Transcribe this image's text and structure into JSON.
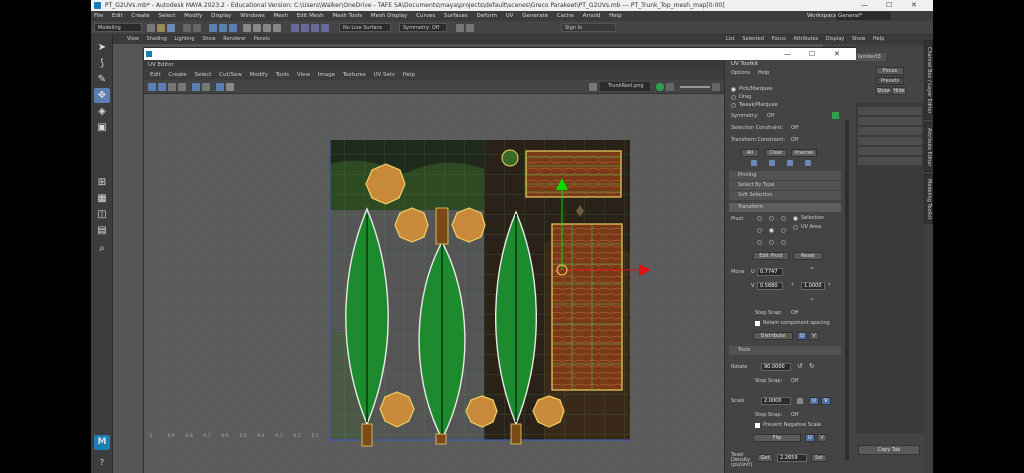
{
  "titlebar": {
    "title": "PT_G2UVs.mb* - Autodesk MAYA 2023.2 - Educational Version: C:\\Users\\Walker\\OneDrive - TAFE SA\\Documents\\maya\\projects\\default\\scenes\\Greco Parakeet\\PT_G2UVs.mb  ---  PT_Trunk_Top_mesh_map[0:00]"
  },
  "menubar": {
    "items": [
      "File",
      "Edit",
      "Create",
      "Select",
      "Modify",
      "Display",
      "Windows",
      "Mesh",
      "Edit Mesh",
      "Mesh Tools",
      "Mesh Display",
      "Curves",
      "Surfaces",
      "Deform",
      "UV",
      "Generate",
      "Cache",
      "Arnold",
      "Help"
    ],
    "workspace_label": "Workspace:",
    "workspace_value": "General*"
  },
  "shelf": {
    "mode": "Modeling",
    "live_surface": "No Live Surface",
    "symmetry": "Symmetry: Off",
    "sign_in": "Sign In"
  },
  "viewport_menu": {
    "items": [
      "View",
      "Shading",
      "Lighting",
      "Show",
      "Renderer",
      "Panels"
    ]
  },
  "uv_editor": {
    "title": "UV Editor",
    "menu": [
      "Edit",
      "Create",
      "Select",
      "Cut/Sew",
      "Modify",
      "Tools",
      "View",
      "Image",
      "Textures",
      "UV Sets",
      "Help"
    ],
    "texture_name": "TrunkRest.png",
    "axis_labels": [
      "-1",
      "-0.9",
      "-0.8",
      "-0.7",
      "-0.6",
      "-0.5",
      "-0.4",
      "-0.3",
      "-0.2",
      "-0.1"
    ]
  },
  "toolkit": {
    "title": "UV Toolkit",
    "menu": [
      "Options",
      "Help"
    ],
    "selection_modes": [
      "Pick/Marquee",
      "Drag",
      "Tweak/Marquee"
    ],
    "symmetry_label": "Symmetry:",
    "symmetry_value": "Off",
    "selection_constraint_label": "Selection Constraint:",
    "selection_constraint_value": "Off",
    "transform_constraint_label": "Transform Constraint:",
    "transform_constraint_value": "Off",
    "buttons_all": "All",
    "buttons_clear": "Clear",
    "buttons_inverse": "Inverse",
    "sections": [
      "Pinning",
      "Select By Type",
      "Soft Selection",
      "Transform",
      "Tools"
    ],
    "pivot_label": "Pivot",
    "pivot_selection": "Selection",
    "pivot_uv_area": "UV Area",
    "edit_pivot": "Edit Pivot",
    "reset": "Reset",
    "move_label": "Move",
    "move_u_label": "U",
    "move_u": "0.7747",
    "move_v_label": "V",
    "move_v": "0.5680",
    "move_step": "1.0000",
    "step_snap_label": "Step Snap:",
    "step_snap_value": "Off",
    "retain_spacing": "Retain component spacing",
    "distribute": "Distribute",
    "u_btn": "U",
    "v_btn": "V",
    "rotate_label": "Rotate",
    "rotate_value": "90.0000",
    "scale_label": "Scale",
    "scale_value": "2.0000",
    "prevent_negative_scale": "Prevent Negative Scale",
    "flip": "Flip",
    "texel_label": "Texel Density (px/unit)",
    "texel_get": "Get",
    "texel_value": "2.2659",
    "texel_set": "Set"
  },
  "right_panel": {
    "menu": [
      "List",
      "Selected",
      "Focus",
      "Attributes",
      "Display",
      "Show",
      "Help"
    ],
    "node": "lambert3",
    "tabs": [
      "Channel Box / Layer Editor",
      "Attribute Editor",
      "Modeling Toolkit"
    ],
    "focus_btn": "Focus",
    "presets_btn": "Presets",
    "show_btn": "Show",
    "hide_btn": "Hide",
    "copy_tab": "Copy Tab"
  },
  "colors": {
    "accent_blue": "#4a6fa5",
    "uv_highlight": "#f0d060",
    "leaf_green": "#1e8a2e",
    "selection_green": "#00dd00",
    "axis_red": "#e01010"
  }
}
